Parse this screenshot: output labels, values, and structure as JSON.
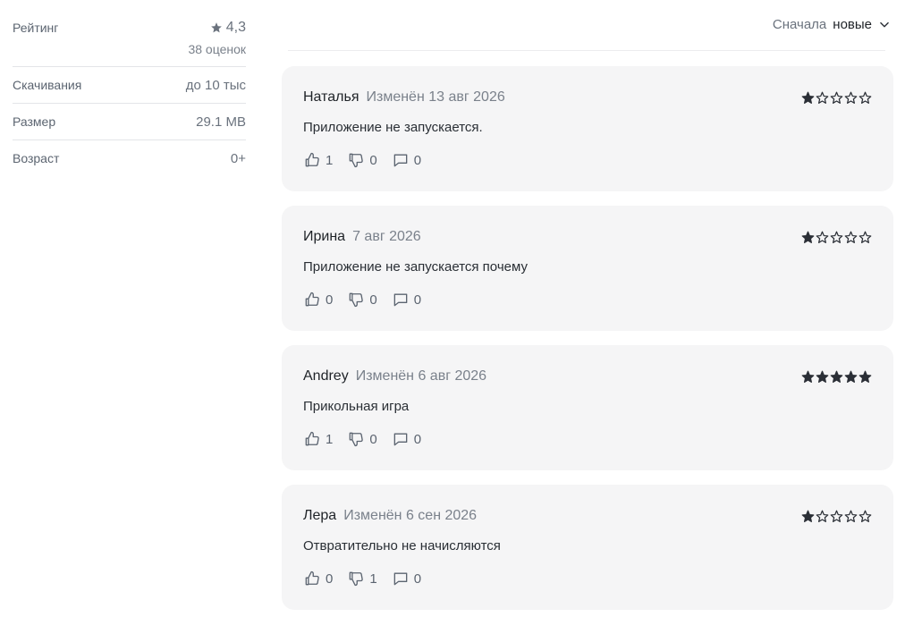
{
  "info": {
    "rating_label": "Рейтинг",
    "rating_value": "4,3",
    "rating_count": "38 оценок",
    "downloads_label": "Скачивания",
    "downloads_value": "до 10 тыс",
    "size_label": "Размер",
    "size_value": "29.1 MB",
    "age_label": "Возраст",
    "age_value": "0+"
  },
  "sort": {
    "label": "Сначала",
    "value": "новые"
  },
  "colors": {
    "star_filled": "#2b2f36",
    "muted": "#7a818b",
    "card_bg": "#f5f5f6"
  },
  "reviews": [
    {
      "author": "Наталья",
      "date": "Изменён 13 авг 2026",
      "rating": 1,
      "text": "Приложение не запускается.",
      "likes": "1",
      "dislikes": "0",
      "comments": "0"
    },
    {
      "author": "Ирина",
      "date": "7 авг 2026",
      "rating": 1,
      "text": "Приложение не запускается почему",
      "likes": "0",
      "dislikes": "0",
      "comments": "0"
    },
    {
      "author": "Andrey",
      "date": "Изменён 6 авг 2026",
      "rating": 5,
      "text": "Прикольная игра",
      "likes": "1",
      "dislikes": "0",
      "comments": "0"
    },
    {
      "author": "Лера",
      "date": "Изменён 6 сен 2026",
      "rating": 1,
      "text": "Отвратительно не начисляются",
      "likes": "0",
      "dislikes": "1",
      "comments": "0"
    }
  ]
}
